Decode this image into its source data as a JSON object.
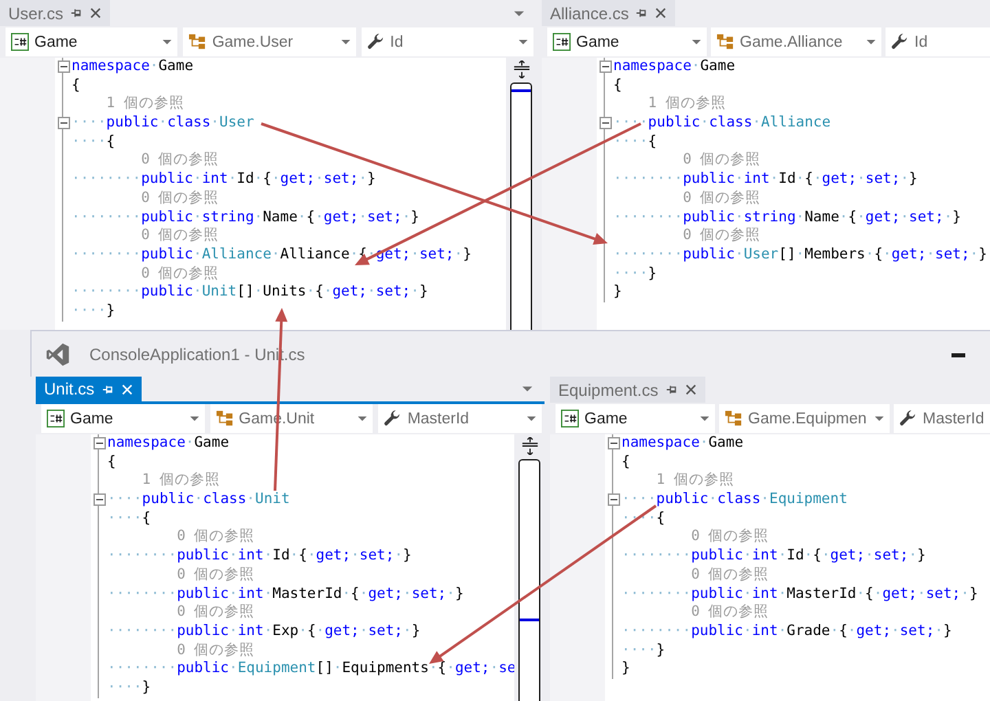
{
  "top_panes": [
    {
      "tab": {
        "label": "User.cs",
        "selected": false
      },
      "tab_menu": true,
      "scrollbar": true,
      "cut_off": false,
      "nav": [
        "Game",
        "Game.User",
        "Id"
      ],
      "lines": [
        {
          "kind": "code",
          "fold": true,
          "segs": [
            {
              "kind": "kw",
              "text": "namespace·"
            },
            {
              "kind": "id",
              "text": "Game"
            }
          ]
        },
        {
          "kind": "code",
          "fold": false,
          "segs": [
            {
              "kind": "id",
              "text": "{"
            }
          ]
        },
        {
          "kind": "ref",
          "text": "1 個の参照"
        },
        {
          "kind": "code",
          "fold": true,
          "segs": [
            {
              "kind": "kw",
              "text": "····public·class·"
            },
            {
              "kind": "type",
              "text": "User"
            }
          ]
        },
        {
          "kind": "code",
          "fold": false,
          "segs": [
            {
              "kind": "id",
              "text": "····{"
            }
          ]
        },
        {
          "kind": "ref",
          "text": "0 個の参照"
        },
        {
          "kind": "code",
          "fold": false,
          "segs": [
            {
              "kind": "kw",
              "text": "········public·int·"
            },
            {
              "kind": "id",
              "text": "Id·{·"
            },
            {
              "kind": "kw",
              "text": "get;·set;·"
            },
            {
              "kind": "id",
              "text": "}"
            }
          ]
        },
        {
          "kind": "ref",
          "text": "0 個の参照"
        },
        {
          "kind": "code",
          "fold": false,
          "segs": [
            {
              "kind": "kw",
              "text": "········public·string·"
            },
            {
              "kind": "id",
              "text": "Name·{·"
            },
            {
              "kind": "kw",
              "text": "get;·set;·"
            },
            {
              "kind": "id",
              "text": "}"
            }
          ]
        },
        {
          "kind": "ref",
          "text": "0 個の参照"
        },
        {
          "kind": "code",
          "fold": false,
          "segs": [
            {
              "kind": "kw",
              "text": "········public·"
            },
            {
              "kind": "type",
              "text": "Alliance"
            },
            {
              "kind": "id",
              "text": "·Alliance·{·"
            },
            {
              "kind": "kw",
              "text": "get;·set;·"
            },
            {
              "kind": "id",
              "text": "}"
            }
          ]
        },
        {
          "kind": "ref",
          "text": "0 個の参照"
        },
        {
          "kind": "code",
          "fold": false,
          "segs": [
            {
              "kind": "kw",
              "text": "········public·"
            },
            {
              "kind": "type",
              "text": "Unit"
            },
            {
              "kind": "id",
              "text": "[]·Units·{·"
            },
            {
              "kind": "kw",
              "text": "get;·set;·"
            },
            {
              "kind": "id",
              "text": "}"
            }
          ]
        },
        {
          "kind": "code",
          "fold": false,
          "segs": [
            {
              "kind": "id",
              "text": "····}"
            }
          ]
        }
      ]
    },
    {
      "tab": {
        "label": "Alliance.cs",
        "selected": false
      },
      "tab_menu": false,
      "scrollbar": false,
      "cut_off": true,
      "nav": [
        "Game",
        "Game.Alliance",
        "Id"
      ],
      "lines": [
        {
          "kind": "code",
          "fold": true,
          "segs": [
            {
              "kind": "kw",
              "text": "namespace·"
            },
            {
              "kind": "id",
              "text": "Game"
            }
          ]
        },
        {
          "kind": "code",
          "fold": false,
          "segs": [
            {
              "kind": "id",
              "text": "{"
            }
          ]
        },
        {
          "kind": "ref",
          "text": "1 個の参照"
        },
        {
          "kind": "code",
          "fold": true,
          "segs": [
            {
              "kind": "kw",
              "text": "····public·class·"
            },
            {
              "kind": "type",
              "text": "Alliance"
            }
          ]
        },
        {
          "kind": "code",
          "fold": false,
          "segs": [
            {
              "kind": "id",
              "text": "····{"
            }
          ]
        },
        {
          "kind": "ref",
          "text": "0 個の参照"
        },
        {
          "kind": "code",
          "fold": false,
          "segs": [
            {
              "kind": "kw",
              "text": "········public·int·"
            },
            {
              "kind": "id",
              "text": "Id·{·"
            },
            {
              "kind": "kw",
              "text": "get;·set;·"
            },
            {
              "kind": "id",
              "text": "}"
            }
          ]
        },
        {
          "kind": "ref",
          "text": "0 個の参照"
        },
        {
          "kind": "code",
          "fold": false,
          "segs": [
            {
              "kind": "kw",
              "text": "········public·string·"
            },
            {
              "kind": "id",
              "text": "Name·{·"
            },
            {
              "kind": "kw",
              "text": "get;·set;·"
            },
            {
              "kind": "id",
              "text": "}"
            }
          ]
        },
        {
          "kind": "ref",
          "text": "0 個の参照"
        },
        {
          "kind": "code",
          "fold": false,
          "segs": [
            {
              "kind": "kw",
              "text": "········public·"
            },
            {
              "kind": "type",
              "text": "User"
            },
            {
              "kind": "id",
              "text": "[]·Members·{·"
            },
            {
              "kind": "kw",
              "text": "get;·set;·"
            },
            {
              "kind": "id",
              "text": "}"
            }
          ]
        },
        {
          "kind": "code",
          "fold": false,
          "segs": [
            {
              "kind": "id",
              "text": "····}"
            }
          ]
        },
        {
          "kind": "code",
          "fold": false,
          "segs": [
            {
              "kind": "id",
              "text": "}"
            }
          ]
        }
      ]
    }
  ],
  "window": {
    "title": "ConsoleApplication1 - Unit.cs",
    "panes": [
      {
        "tab": {
          "label": "Unit.cs",
          "selected": true
        },
        "tab_menu": true,
        "scrollbar": true,
        "cut_off": false,
        "nav": [
          "Game",
          "Game.Unit",
          "MasterId"
        ],
        "lines": [
          {
            "kind": "code",
            "fold": true,
            "segs": [
              {
                "kind": "kw",
                "text": "namespace·"
              },
              {
                "kind": "id",
                "text": "Game"
              }
            ]
          },
          {
            "kind": "code",
            "fold": false,
            "segs": [
              {
                "kind": "id",
                "text": "{"
              }
            ]
          },
          {
            "kind": "ref",
            "text": "1 個の参照"
          },
          {
            "kind": "code",
            "fold": true,
            "segs": [
              {
                "kind": "kw",
                "text": "····public·class·"
              },
              {
                "kind": "type",
                "text": "Unit"
              }
            ]
          },
          {
            "kind": "code",
            "fold": false,
            "segs": [
              {
                "kind": "id",
                "text": "····{"
              }
            ]
          },
          {
            "kind": "ref",
            "text": "0 個の参照"
          },
          {
            "kind": "code",
            "fold": false,
            "segs": [
              {
                "kind": "kw",
                "text": "········public·int·"
              },
              {
                "kind": "id",
                "text": "Id·{·"
              },
              {
                "kind": "kw",
                "text": "get;·set;·"
              },
              {
                "kind": "id",
                "text": "}"
              }
            ]
          },
          {
            "kind": "ref",
            "text": "0 個の参照"
          },
          {
            "kind": "code",
            "fold": false,
            "segs": [
              {
                "kind": "kw",
                "text": "········public·int·"
              },
              {
                "kind": "id",
                "text": "MasterId·{·"
              },
              {
                "kind": "kw",
                "text": "get;·set;·"
              },
              {
                "kind": "id",
                "text": "}"
              }
            ]
          },
          {
            "kind": "ref",
            "text": "0 個の参照"
          },
          {
            "kind": "code",
            "fold": false,
            "segs": [
              {
                "kind": "kw",
                "text": "········public·int·"
              },
              {
                "kind": "id",
                "text": "Exp·{·"
              },
              {
                "kind": "kw",
                "text": "get;·set;·"
              },
              {
                "kind": "id",
                "text": "}"
              }
            ]
          },
          {
            "kind": "ref",
            "text": "0 個の参照"
          },
          {
            "kind": "code",
            "fold": false,
            "segs": [
              {
                "kind": "kw",
                "text": "········public·"
              },
              {
                "kind": "type",
                "text": "Equipment"
              },
              {
                "kind": "id",
                "text": "[]·Equipments·{·"
              },
              {
                "kind": "kw",
                "text": "get;·se"
              }
            ]
          },
          {
            "kind": "code",
            "fold": false,
            "segs": [
              {
                "kind": "id",
                "text": "····}"
              }
            ]
          }
        ]
      },
      {
        "tab": {
          "label": "Equipment.cs",
          "selected": false
        },
        "tab_menu": false,
        "scrollbar": false,
        "cut_off": true,
        "nav": [
          "Game",
          "Game.Equipmen",
          "MasterId"
        ],
        "lines": [
          {
            "kind": "code",
            "fold": true,
            "segs": [
              {
                "kind": "kw",
                "text": "namespace·"
              },
              {
                "kind": "id",
                "text": "Game"
              }
            ]
          },
          {
            "kind": "code",
            "fold": false,
            "segs": [
              {
                "kind": "id",
                "text": "{"
              }
            ]
          },
          {
            "kind": "ref",
            "text": "1 個の参照"
          },
          {
            "kind": "code",
            "fold": true,
            "segs": [
              {
                "kind": "kw",
                "text": "····public·class·"
              },
              {
                "kind": "type",
                "text": "Equipment"
              }
            ]
          },
          {
            "kind": "code",
            "fold": false,
            "segs": [
              {
                "kind": "id",
                "text": "····{"
              }
            ]
          },
          {
            "kind": "ref",
            "text": "0 個の参照"
          },
          {
            "kind": "code",
            "fold": false,
            "segs": [
              {
                "kind": "kw",
                "text": "········public·int·"
              },
              {
                "kind": "id",
                "text": "Id·{·"
              },
              {
                "kind": "kw",
                "text": "get;·set;·"
              },
              {
                "kind": "id",
                "text": "}"
              }
            ]
          },
          {
            "kind": "ref",
            "text": "0 個の参照"
          },
          {
            "kind": "code",
            "fold": false,
            "segs": [
              {
                "kind": "kw",
                "text": "········public·int·"
              },
              {
                "kind": "id",
                "text": "MasterId·{·"
              },
              {
                "kind": "kw",
                "text": "get;·set;·"
              },
              {
                "kind": "id",
                "text": "}"
              }
            ]
          },
          {
            "kind": "ref",
            "text": "0 個の参照"
          },
          {
            "kind": "code",
            "fold": false,
            "segs": [
              {
                "kind": "kw",
                "text": "········public·int·"
              },
              {
                "kind": "id",
                "text": "Grade·{·"
              },
              {
                "kind": "kw",
                "text": "get;·set;·"
              },
              {
                "kind": "id",
                "text": "}"
              }
            ]
          },
          {
            "kind": "code",
            "fold": false,
            "segs": [
              {
                "kind": "id",
                "text": "····}"
              }
            ]
          },
          {
            "kind": "code",
            "fold": false,
            "segs": [
              {
                "kind": "id",
                "text": "}"
              }
            ]
          }
        ]
      }
    ]
  }
}
